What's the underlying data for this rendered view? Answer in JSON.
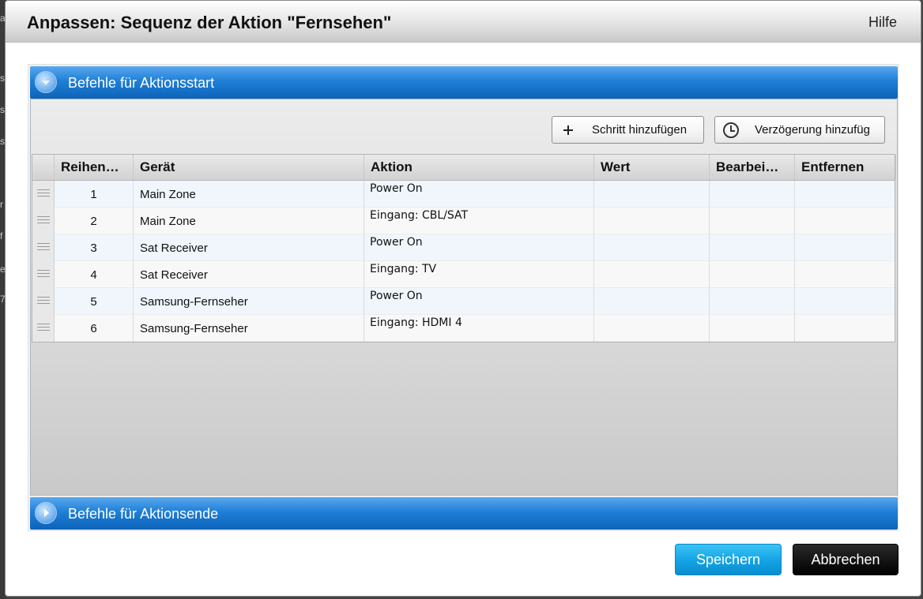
{
  "background_fragments": [
    "a",
    "s",
    "s",
    "s",
    "r",
    "f",
    "e",
    "7"
  ],
  "dialog": {
    "title": "Anpassen: Sequenz der Aktion \"Fernsehen\"",
    "help_label": "Hilfe"
  },
  "accordion": {
    "start_section": {
      "label": "Befehle für Aktionsstart",
      "expanded": true,
      "toolbar": {
        "add_step_label": "Schritt hinzufügen",
        "add_delay_label": "Verzögerung hinzufüg"
      },
      "table": {
        "columns": {
          "order": "Reihen…",
          "device": "Gerät",
          "action": "Aktion",
          "value": "Wert",
          "edit": "Bearbei…",
          "remove": "Entfernen"
        },
        "rows": [
          {
            "order": "1",
            "device": "Main Zone",
            "action": "Power On",
            "value": "",
            "edit": "",
            "remove": ""
          },
          {
            "order": "2",
            "device": "Main Zone",
            "action": "Eingang: CBL/SAT",
            "value": "",
            "edit": "",
            "remove": ""
          },
          {
            "order": "3",
            "device": "Sat Receiver",
            "action": "Power On",
            "value": "",
            "edit": "",
            "remove": ""
          },
          {
            "order": "4",
            "device": "Sat Receiver",
            "action": "Eingang: TV",
            "value": "",
            "edit": "",
            "remove": ""
          },
          {
            "order": "5",
            "device": "Samsung-Fernseher",
            "action": "Power On",
            "value": "",
            "edit": "",
            "remove": ""
          },
          {
            "order": "6",
            "device": "Samsung-Fernseher",
            "action": "Eingang: HDMI 4",
            "value": "",
            "edit": "",
            "remove": ""
          }
        ]
      }
    },
    "end_section": {
      "label": "Befehle für Aktionsende",
      "expanded": false
    }
  },
  "footer": {
    "save_label": "Speichern",
    "cancel_label": "Abbrechen"
  },
  "colors": {
    "accordion_blue": "#1f7fd6",
    "save_blue": "#12a2e4",
    "cancel_black": "#000000"
  }
}
